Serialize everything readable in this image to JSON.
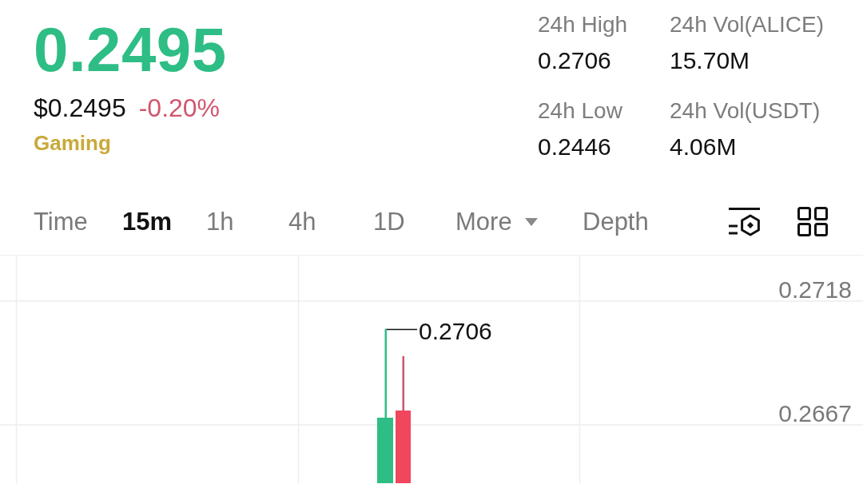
{
  "ticker": {
    "last_price": "0.2495",
    "price_rising": true,
    "usd_price": "$0.2495",
    "change_percent": "-0.20%",
    "change_rising": false,
    "category": "Gaming"
  },
  "stats": [
    {
      "label": "24h High",
      "value": "0.2706"
    },
    {
      "label": "24h Vol(ALICE)",
      "value": "15.70M"
    },
    {
      "label": "24h Low",
      "value": "0.2446"
    },
    {
      "label": "24h Vol(USDT)",
      "value": "4.06M"
    }
  ],
  "chart_tabs": [
    {
      "label": "Time",
      "kind": "tab",
      "selected": false
    },
    {
      "label": "15m",
      "kind": "tab",
      "selected": true
    },
    {
      "label": "1h",
      "kind": "tab",
      "selected": false
    },
    {
      "label": "4h",
      "kind": "tab",
      "selected": false
    },
    {
      "label": "1D",
      "kind": "tab",
      "selected": false
    },
    {
      "label": "More",
      "kind": "dropdown",
      "selected": false
    },
    {
      "label": "Depth",
      "kind": "tab",
      "selected": false
    }
  ],
  "chart": {
    "price_labels": [
      "0.2718",
      "0.2667"
    ],
    "high_label": "0.2706"
  }
}
